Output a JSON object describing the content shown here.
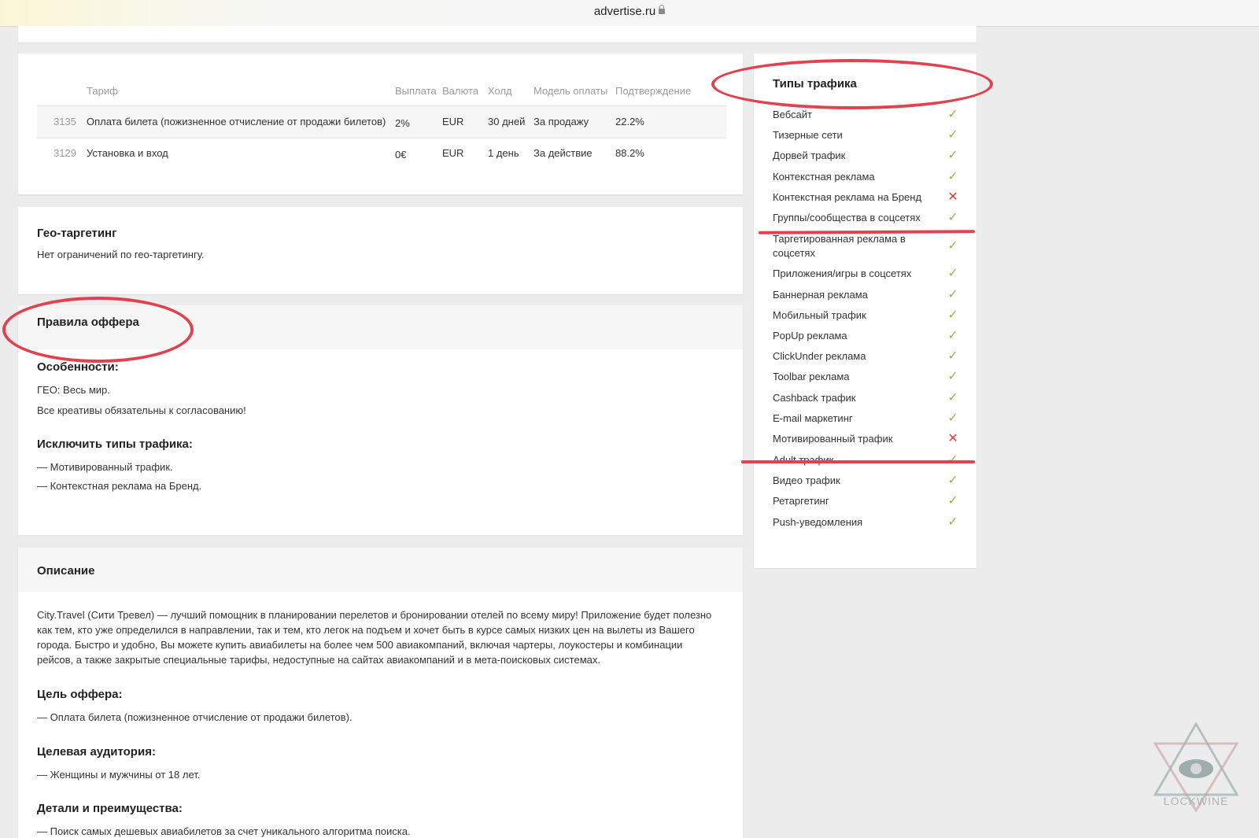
{
  "browser": {
    "url": "advertise.ru"
  },
  "tariffs": {
    "headers": [
      "Тариф",
      "Выплата",
      "Валюта",
      "Холд",
      "Модель оплаты",
      "Подтверждение"
    ],
    "rows": [
      {
        "id": "3135",
        "name": "Оплата билета (пожизненное отчисление от продажи билетов)",
        "payout": "2%",
        "currency": "EUR",
        "hold": "30 дней",
        "model": "За продажу",
        "confirm": "22.2%"
      },
      {
        "id": "3129",
        "name": "Установка и вход",
        "payout": "0€",
        "currency": "EUR",
        "hold": "1 день",
        "model": "За действие",
        "confirm": "88.2%"
      }
    ]
  },
  "geo": {
    "title": "Гео-таргетинг",
    "text": "Нет ограничений по гео-таргетингу."
  },
  "rules": {
    "title": "Правила оффера",
    "features_title": "Особенности:",
    "features": [
      "ГЕО: Весь мир.",
      "Все креативы обязательны к согласованию!"
    ],
    "exclude_title": "Исключить типы трафика:",
    "exclude": [
      "— Мотивированный трафик.",
      "— Контекстная реклама на Бренд."
    ]
  },
  "description": {
    "title": "Описание",
    "text": "City.Travel (Сити Тревел) — лучший помощник в планировании перелетов и бронировании отелей по всему миру! Приложение будет полезно как тем, кто уже определился в направлении, так и тем, кто легок на подъем и хочет быть в курсе самых низких цен на вылеты из Вашего города. Быстро и удобно, Вы можете купить авиабилеты на более чем 500 авиакомпаний, включая чартеры, лоукостеры и комбинации рейсов, а также закрытые специальные тарифы, недоступные на сайтах авиакомпаний и в мета-поисковых системах.",
    "goal_title": "Цель оффера:",
    "goal": "— Оплата билета (пожизненное отчисление от продажи билетов).",
    "audience_title": "Целевая аудитория:",
    "audience": "— Женщины и мужчины от 18 лет.",
    "details_title": "Детали и преимущества:",
    "details": "— Поиск самых дешевых авиабилетов за счет уникального алгоритма поиска."
  },
  "traffic_types": {
    "title": "Типы трафика",
    "items": [
      {
        "label": "Вебсайт",
        "allowed": true
      },
      {
        "label": "Тизерные сети",
        "allowed": true
      },
      {
        "label": "Дорвей трафик",
        "allowed": true
      },
      {
        "label": "Контекстная реклама",
        "allowed": true
      },
      {
        "label": "Контекстная реклама на Бренд",
        "allowed": false
      },
      {
        "label": "Группы/сообщества в соцсетях",
        "allowed": true
      },
      {
        "label": "Таргетированная реклама в соцсетях",
        "allowed": true
      },
      {
        "label": "Приложения/игры в соцсетях",
        "allowed": true
      },
      {
        "label": "Баннерная реклама",
        "allowed": true
      },
      {
        "label": "Мобильный трафик",
        "allowed": true
      },
      {
        "label": "PopUp реклама",
        "allowed": true
      },
      {
        "label": "ClickUnder реклама",
        "allowed": true
      },
      {
        "label": "Toolbar реклама",
        "allowed": true
      },
      {
        "label": "Cashback трафик",
        "allowed": true
      },
      {
        "label": "E-mail маркетинг",
        "allowed": true
      },
      {
        "label": "Мотивированный трафик",
        "allowed": false
      },
      {
        "label": "Adult трафик",
        "allowed": true
      },
      {
        "label": "Видео трафик",
        "allowed": true
      },
      {
        "label": "Ретаргетинг",
        "allowed": true
      },
      {
        "label": "Push-уведомления",
        "allowed": true
      }
    ],
    "mark_allowed": "✓",
    "mark_denied": "✕"
  },
  "colors": {
    "annotation": "#e0434f",
    "allowed": "#8cbf3f",
    "denied": "#e23c3c"
  },
  "watermark": {
    "text": "LOCKWINE"
  }
}
